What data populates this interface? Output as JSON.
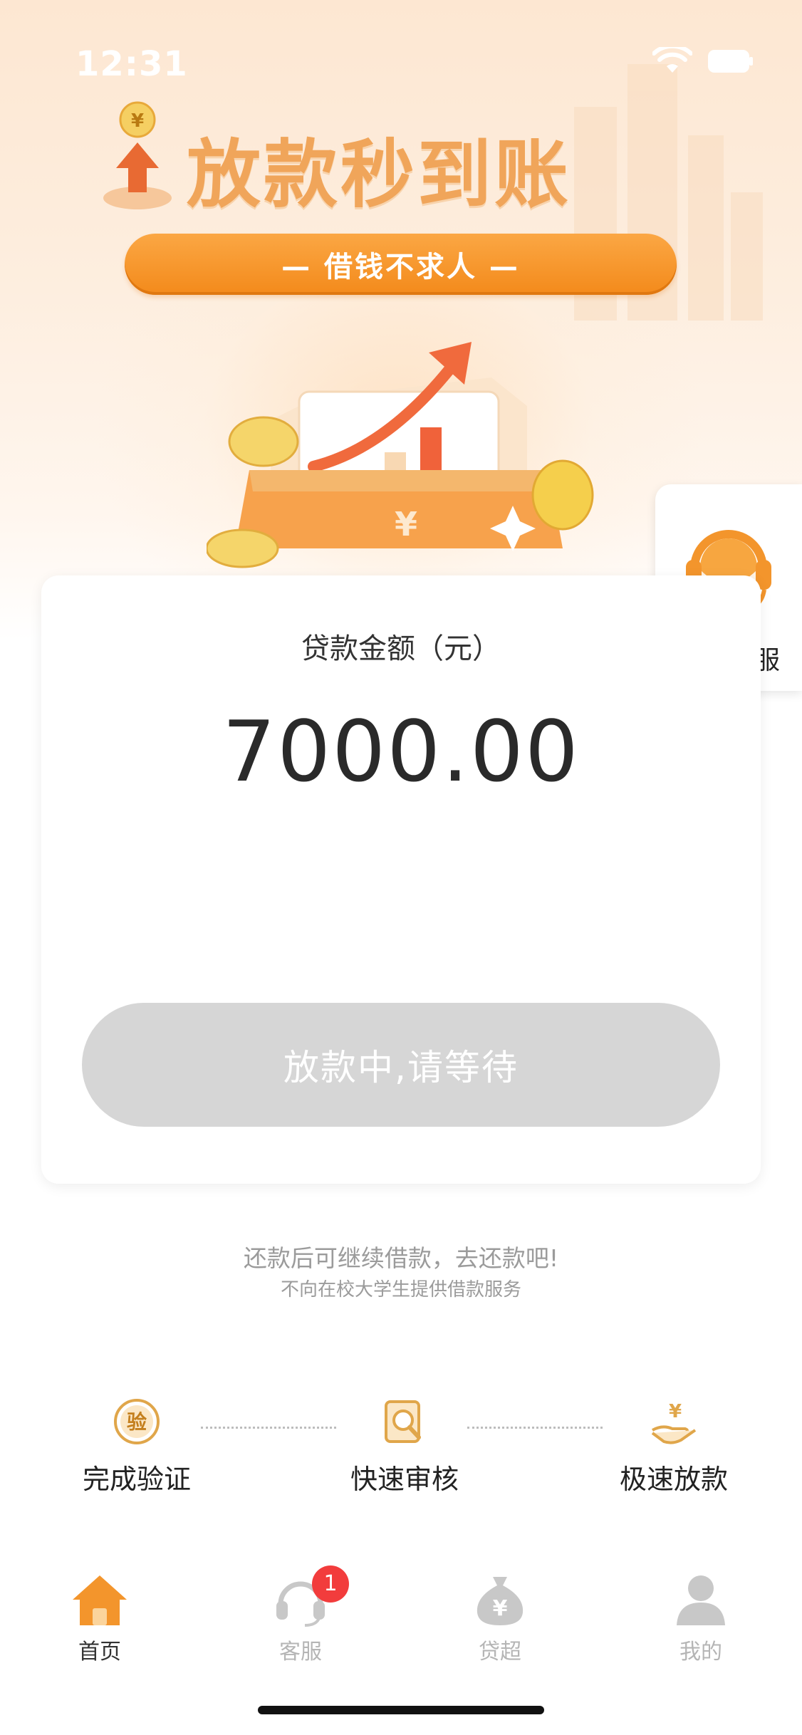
{
  "status_bar": {
    "time": "12:31"
  },
  "hero": {
    "title": "放款秒到账",
    "slogan": "— 借钱不求人 —",
    "badge_symbol": "¥",
    "wallet_symbol": "¥"
  },
  "customer_service_float": {
    "label": "在线客服",
    "icon": "headset-agent-icon"
  },
  "loan_card": {
    "label": "贷款金额（元）",
    "amount": "7000.00",
    "button_label": "放款中,请等待"
  },
  "notes": {
    "line1": "还款后可继续借款，去还款吧!",
    "line2": "不向在校大学生提供借款服务"
  },
  "steps": [
    {
      "label": "完成验证",
      "icon": "verify-seal-icon",
      "icon_char": "验"
    },
    {
      "label": "快速审核",
      "icon": "review-magnifier-icon"
    },
    {
      "label": "极速放款",
      "icon": "hand-money-icon",
      "icon_char": "¥"
    }
  ],
  "tabbar": {
    "tabs": [
      {
        "label": "首页",
        "icon": "home-icon",
        "active": true
      },
      {
        "label": "客服",
        "icon": "headset-icon",
        "badge": "1"
      },
      {
        "label": "贷超",
        "icon": "money-bag-icon",
        "icon_char": "¥"
      },
      {
        "label": "我的",
        "icon": "user-icon"
      }
    ]
  },
  "colors": {
    "accent": "#f38a1b",
    "title": "#f0a55a",
    "button_disabled": "#d6d6d6",
    "badge": "#f23c3c",
    "icon_gold": "#e0a64a"
  }
}
